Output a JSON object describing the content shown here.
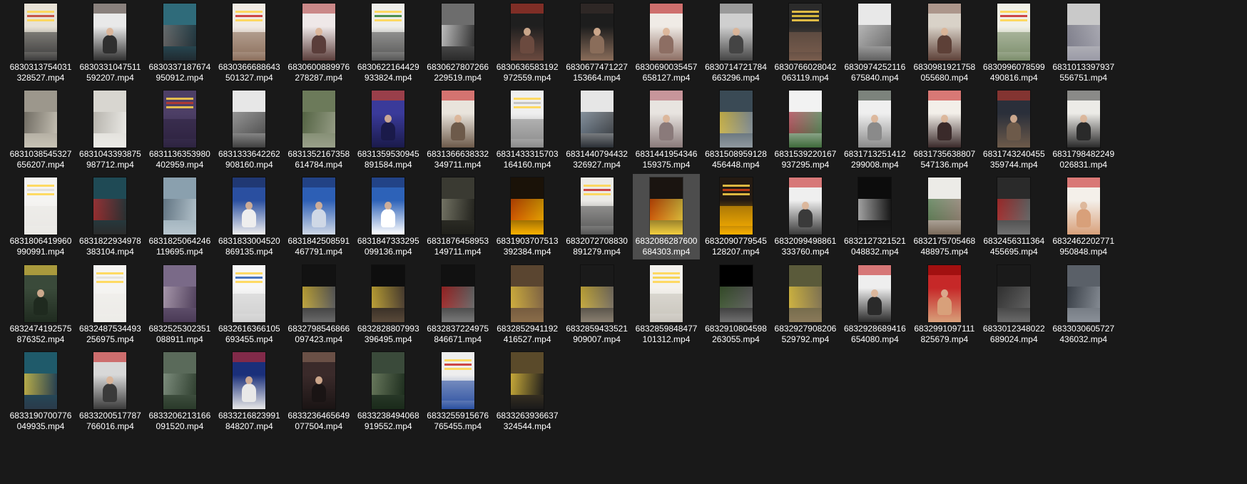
{
  "window": {
    "background": "#191919",
    "selected_index": 41
  },
  "columns": 16,
  "files": [
    {
      "line1": "6830313754031",
      "line2": "328527.mp4",
      "colors": [
        "#e8e2d6",
        "#c0392b",
        "#3a3a3a"
      ],
      "style": "text"
    },
    {
      "line1": "6830331047511",
      "line2": "592207.mp4",
      "colors": [
        "#e9e9e9",
        "#4a3b34",
        "#2f2f2f"
      ],
      "style": "person"
    },
    {
      "line1": "6830337187674",
      "line2": "950912.mp4",
      "colors": [
        "#2f6b7a",
        "#7a6a66",
        "#202a30"
      ],
      "style": "scene"
    },
    {
      "line1": "6830366688643",
      "line2": "501327.mp4",
      "colors": [
        "#f1ebe4",
        "#c62828",
        "#8a6d5a"
      ],
      "style": "text"
    },
    {
      "line1": "6830600889976",
      "line2": "278287.mp4",
      "colors": [
        "#efe8e8",
        "#b04747",
        "#5a3d3a"
      ],
      "style": "person"
    },
    {
      "line1": "6830622164429",
      "line2": "933824.mp4",
      "colors": [
        "#eeeeea",
        "#2e7d32",
        "#555555"
      ],
      "style": "text"
    },
    {
      "line1": "6830627807266",
      "line2": "229519.mp4",
      "colors": [
        "#6d6d6d",
        "#dcdcdc",
        "#2a2a2a"
      ],
      "style": "scene"
    },
    {
      "line1": "6830636583192",
      "line2": "972559.mp4",
      "colors": [
        "#1f1f1f",
        "#c0392b",
        "#6b4a3f"
      ],
      "style": "person"
    },
    {
      "line1": "6830677471227",
      "line2": "153664.mp4",
      "colors": [
        "#1d1d1d",
        "#3a2f2b",
        "#8a6d5a"
      ],
      "style": "person"
    },
    {
      "line1": "6830690035457",
      "line2": "658127.mp4",
      "colors": [
        "#f0ebe6",
        "#b71c1c",
        "#8d6e63"
      ],
      "style": "person"
    },
    {
      "line1": "6830714721784",
      "line2": "663296.mp4",
      "colors": [
        "#cfcfcf",
        "#777777",
        "#444444"
      ],
      "style": "person"
    },
    {
      "line1": "6830766028042",
      "line2": "063119.mp4",
      "colors": [
        "#2b2b2b",
        "#f4d03f",
        "#7b5e4e"
      ],
      "style": "text"
    },
    {
      "line1": "6830974252116",
      "line2": "675840.mp4",
      "colors": [
        "#e8e8e8",
        "#9e9e9e",
        "#5f5f5f"
      ],
      "style": "scene"
    },
    {
      "line1": "6830981921758",
      "line2": "055680.mp4",
      "colors": [
        "#d9d2c8",
        "#8d6e63",
        "#5d4037"
      ],
      "style": "person"
    },
    {
      "line1": "6830996078599",
      "line2": "490816.mp4",
      "colors": [
        "#f1f1e8",
        "#c62828",
        "#7a8c6a"
      ],
      "style": "text"
    },
    {
      "line1": "6831013397937",
      "line2": "556751.mp4",
      "colors": [
        "#c9c9c9",
        "#6a6a7a",
        "#9a9aa6"
      ],
      "style": "scene"
    },
    {
      "line1": "6831038545327",
      "line2": "656207.mp4",
      "colors": [
        "#9c978c",
        "#5e5a52",
        "#c8c3b6"
      ],
      "style": "scene"
    },
    {
      "line1": "6831043393875",
      "line2": "987712.mp4",
      "colors": [
        "#d8d6d0",
        "#a8a59e",
        "#ecebe7"
      ],
      "style": "scene"
    },
    {
      "line1": "6831136353980",
      "line2": "402959.mp4",
      "colors": [
        "#4d3f66",
        "#c0392b",
        "#2d2340"
      ],
      "style": "text"
    },
    {
      "line1": "6831333642262",
      "line2": "908160.mp4",
      "colors": [
        "#e7e7e7",
        "#707070",
        "#3f3f3f"
      ],
      "style": "scene"
    },
    {
      "line1": "6831352167358",
      "line2": "614784.mp4",
      "colors": [
        "#6c7a5a",
        "#4a5a3a",
        "#9aa08a"
      ],
      "style": "scene"
    },
    {
      "line1": "6831359530945",
      "line2": "891584.mp4",
      "colors": [
        "#3a3a9a",
        "#d84315",
        "#1a1a4a"
      ],
      "style": "person"
    },
    {
      "line1": "6831366638332",
      "line2": "349711.mp4",
      "colors": [
        "#e9e4dc",
        "#c62828",
        "#6d5a4a"
      ],
      "style": "person"
    },
    {
      "line1": "6831433315703",
      "line2": "164160.mp4",
      "colors": [
        "#efefef",
        "#bdbdbd",
        "#8a8a8a"
      ],
      "style": "text"
    },
    {
      "line1": "6831440794432",
      "line2": "326927.mp4",
      "colors": [
        "#e6e6e6",
        "#5a6a7a",
        "#2a2f35"
      ],
      "style": "scene"
    },
    {
      "line1": "6831441954346",
      "line2": "159375.mp4",
      "colors": [
        "#e8e4e0",
        "#b0606a",
        "#8a7a7a"
      ],
      "style": "person"
    },
    {
      "line1": "6831508959128",
      "line2": "456448.mp4",
      "colors": [
        "#3a4a55",
        "#f4d03f",
        "#909aa0"
      ],
      "style": "scene"
    },
    {
      "line1": "6831539220167",
      "line2": "937295.mp4",
      "colors": [
        "#f2f2f2",
        "#a12a3a",
        "#3e6a3a"
      ],
      "style": "scene"
    },
    {
      "line1": "6831713251412",
      "line2": "299008.mp4",
      "colors": [
        "#efefef",
        "#2e3a2e",
        "#8a8a8a"
      ],
      "style": "person"
    },
    {
      "line1": "6831735638807",
      "line2": "547136.mp4",
      "colors": [
        "#f3efe9",
        "#c62828",
        "#3a2a2a"
      ],
      "style": "person"
    },
    {
      "line1": "6831743240455",
      "line2": "359744.mp4",
      "colors": [
        "#2a2f3a",
        "#c0392b",
        "#6d5a4a"
      ],
      "style": "person"
    },
    {
      "line1": "6831798482249",
      "line2": "026831.mp4",
      "colors": [
        "#ecebe7",
        "#4a4a4a",
        "#2a2a2a"
      ],
      "style": "person"
    },
    {
      "line1": "6831806419960",
      "line2": "990991.mp4",
      "colors": [
        "#f5f4f2",
        "#dedcd8",
        "#e9e8e4"
      ],
      "style": "text"
    },
    {
      "line1": "6831822934978",
      "line2": "383104.mp4",
      "colors": [
        "#1f4a55",
        "#c62828",
        "#2b2b2b"
      ],
      "style": "scene"
    },
    {
      "line1": "6831825064246",
      "line2": "119695.mp4",
      "colors": [
        "#8aa0ae",
        "#506270",
        "#b8c6ce"
      ],
      "style": "scene"
    },
    {
      "line1": "6831833004520",
      "line2": "869135.mp4",
      "colors": [
        "#2a4fa0",
        "#1a2a55",
        "#eeeeee"
      ],
      "style": "person"
    },
    {
      "line1": "6831842508591",
      "line2": "467791.mp4",
      "colors": [
        "#2d5fb5",
        "#1a2f66",
        "#cfd8e6"
      ],
      "style": "person"
    },
    {
      "line1": "6831847333295",
      "line2": "099136.mp4",
      "colors": [
        "#2d62b8",
        "#1a2f66",
        "#ffffff"
      ],
      "style": "person"
    },
    {
      "line1": "6831876458953",
      "line2": "149711.mp4",
      "colors": [
        "#3a3a32",
        "#8a8a78",
        "#1f1f1a"
      ],
      "style": "scene"
    },
    {
      "line1": "6831903707513",
      "line2": "392384.mp4",
      "colors": [
        "#1a1208",
        "#e65100",
        "#ffb300"
      ],
      "style": "scene"
    },
    {
      "line1": "6832072708830",
      "line2": "891279.mp4",
      "colors": [
        "#ecebe7",
        "#c62828",
        "#555555"
      ],
      "style": "text"
    },
    {
      "line1": "6832086287600",
      "line2": "684303.mp4",
      "colors": [
        "#1a1410",
        "#e65100",
        "#f4d03f"
      ],
      "style": "scene"
    },
    {
      "line1": "6832090779545",
      "line2": "128207.mp4",
      "colors": [
        "#241a12",
        "#d84315",
        "#ffb300"
      ],
      "style": "text"
    },
    {
      "line1": "6832099498861",
      "line2": "333760.mp4",
      "colors": [
        "#efefef",
        "#c62828",
        "#3a3a3a"
      ],
      "style": "person"
    },
    {
      "line1": "6832127321521",
      "line2": "048832.mp4",
      "colors": [
        "#0c0c0c",
        "#e0e0e0",
        "#1a1a1a"
      ],
      "style": "scene"
    },
    {
      "line1": "6832175705468",
      "line2": "488975.mp4",
      "colors": [
        "#ecebe7",
        "#3e6a3a",
        "#7a6a5a"
      ],
      "style": "scene"
    },
    {
      "line1": "6832456311364",
      "line2": "455695.mp4",
      "colors": [
        "#2a2a2a",
        "#c62828",
        "#707070"
      ],
      "style": "scene"
    },
    {
      "line1": "6832462202771",
      "line2": "950848.mp4",
      "colors": [
        "#f4f0ea",
        "#c62828",
        "#d8a07a"
      ],
      "style": "person"
    },
    {
      "line1": "6832474192575",
      "line2": "876352.mp4",
      "colors": [
        "#3a4a3a",
        "#f4d03f",
        "#1f2a1f"
      ],
      "style": "person"
    },
    {
      "line1": "6832487534493",
      "line2": "256975.mp4",
      "colors": [
        "#f5f4f2",
        "#e2e0dc",
        "#ecebe7"
      ],
      "style": "text"
    },
    {
      "line1": "6832525302351",
      "line2": "088911.mp4",
      "colors": [
        "#7a6a88",
        "#b8a8b8",
        "#4a3a55"
      ],
      "style": "scene"
    },
    {
      "line1": "6832616366105",
      "line2": "693455.mp4",
      "colors": [
        "#f7f7f7",
        "#2a5fb5",
        "#cfcfcf"
      ],
      "style": "text"
    },
    {
      "line1": "6832798546866",
      "line2": "097423.mp4",
      "colors": [
        "#121212",
        "#f4d03f",
        "#6a6a6a"
      ],
      "style": "scene"
    },
    {
      "line1": "6832828807993",
      "line2": "396495.mp4",
      "colors": [
        "#0e0e0e",
        "#f4d03f",
        "#5a4a3a"
      ],
      "style": "scene"
    },
    {
      "line1": "6832837224975",
      "line2": "846671.mp4",
      "colors": [
        "#111111",
        "#c62828",
        "#7a7a7a"
      ],
      "style": "scene"
    },
    {
      "line1": "6832852941192",
      "line2": "416527.mp4",
      "colors": [
        "#5a4530",
        "#f4d03f",
        "#8a6d4a"
      ],
      "style": "scene"
    },
    {
      "line1": "6832859433521",
      "line2": "909007.mp4",
      "colors": [
        "#1a1a1a",
        "#f4d03f",
        "#8a8070"
      ],
      "style": "scene"
    },
    {
      "line1": "6832859848477",
      "line2": "101312.mp4",
      "colors": [
        "#f4f2ee",
        "#f4d03f",
        "#c8c4bc"
      ],
      "style": "text"
    },
    {
      "line1": "6832910804598",
      "line2": "263055.mp4",
      "colors": [
        "#000000",
        "#4a6a3a",
        "#707070"
      ],
      "style": "scene"
    },
    {
      "line1": "6832927908206",
      "line2": "529792.mp4",
      "colors": [
        "#5a5a3a",
        "#f4d03f",
        "#8a7a5a"
      ],
      "style": "scene"
    },
    {
      "line1": "6832928689416",
      "line2": "654080.mp4",
      "colors": [
        "#eeeeee",
        "#c62828",
        "#2a2a2a"
      ],
      "style": "person"
    },
    {
      "line1": "6832991097111",
      "line2": "825679.mp4",
      "colors": [
        "#c62828",
        "#8b0000",
        "#d8a07a"
      ],
      "style": "person"
    },
    {
      "line1": "6833012348022",
      "line2": "689024.mp4",
      "colors": [
        "#1a1a1a",
        "#3a3a3a",
        "#6a6a6a"
      ],
      "style": "scene"
    },
    {
      "line1": "6833030605727",
      "line2": "436032.mp4",
      "colors": [
        "#5a6068",
        "#2a3038",
        "#8a9098"
      ],
      "style": "scene"
    },
    {
      "line1": "6833190700776",
      "line2": "049935.mp4",
      "colors": [
        "#1f5a6a",
        "#f4d03f",
        "#2a3a4a"
      ],
      "style": "scene"
    },
    {
      "line1": "6833200517787",
      "line2": "766016.mp4",
      "colors": [
        "#d8d8d8",
        "#c62828",
        "#3a3a3a"
      ],
      "style": "person"
    },
    {
      "line1": "6833206213166",
      "line2": "091520.mp4",
      "colors": [
        "#5a6a5a",
        "#8a9a8a",
        "#2a3a2a"
      ],
      "style": "scene"
    },
    {
      "line1": "6833216823991",
      "line2": "848207.mp4",
      "colors": [
        "#1a2f7a",
        "#c62828",
        "#e8e8e8"
      ],
      "style": "person"
    },
    {
      "line1": "6833236465649",
      "line2": "077504.mp4",
      "colors": [
        "#3a2a2a",
        "#8a6a5a",
        "#1a1414"
      ],
      "style": "person"
    },
    {
      "line1": "6833238494068",
      "line2": "919552.mp4",
      "colors": [
        "#3a4a3a",
        "#7a8a6a",
        "#1a2a1a"
      ],
      "style": "scene"
    },
    {
      "line1": "6833255915676",
      "line2": "765455.mp4",
      "colors": [
        "#eeeeee",
        "#c62828",
        "#2a4fa0"
      ],
      "style": "text"
    },
    {
      "line1": "6833263936637",
      "line2": "324544.mp4",
      "colors": [
        "#5a4a2a",
        "#f4d03f",
        "#1a1a1a"
      ],
      "style": "scene"
    }
  ]
}
